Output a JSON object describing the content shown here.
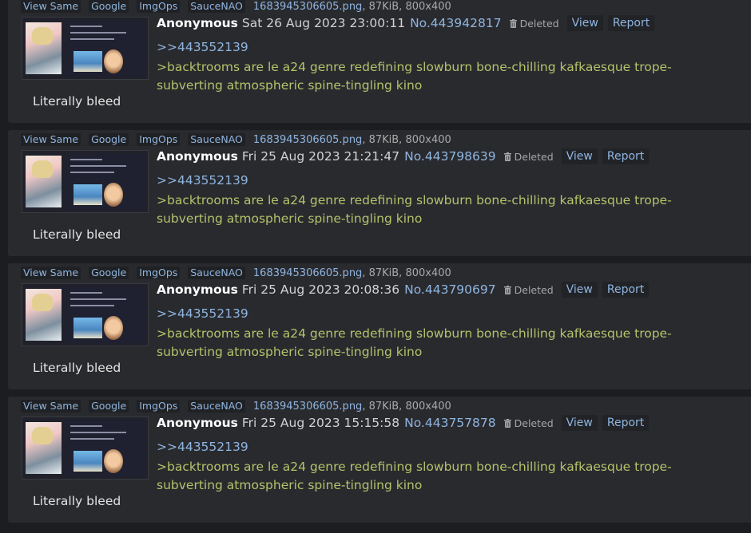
{
  "posts": [
    {
      "links": [
        "View Same",
        "Google",
        "ImgOps",
        "SauceNAO"
      ],
      "file_name": "1683945306605.png",
      "file_info": ", 87KiB, 800x400",
      "name": "Anonymous",
      "date": "Sat 26 Aug 2023 23:00:11",
      "post_no": "No.443942817",
      "deleted": "Deleted",
      "view": "View",
      "report": "Report",
      "quote": ">>443552139",
      "greentext": ">backtrooms are le a24 genre redefining slowburn bone-chilling kafkaesque trope-subverting atmospheric spine-tingling kino",
      "comment": "Literally bleed"
    },
    {
      "links": [
        "View Same",
        "Google",
        "ImgOps",
        "SauceNAO"
      ],
      "file_name": "1683945306605.png",
      "file_info": ", 87KiB, 800x400",
      "name": "Anonymous",
      "date": "Fri 25 Aug 2023 21:21:47",
      "post_no": "No.443798639",
      "deleted": "Deleted",
      "view": "View",
      "report": "Report",
      "quote": ">>443552139",
      "greentext": ">backtrooms are le a24 genre redefining slowburn bone-chilling kafkaesque trope-subverting atmospheric spine-tingling kino",
      "comment": "Literally bleed"
    },
    {
      "links": [
        "View Same",
        "Google",
        "ImgOps",
        "SauceNAO"
      ],
      "file_name": "1683945306605.png",
      "file_info": ", 87KiB, 800x400",
      "name": "Anonymous",
      "date": "Fri 25 Aug 2023 20:08:36",
      "post_no": "No.443790697",
      "deleted": "Deleted",
      "view": "View",
      "report": "Report",
      "quote": ">>443552139",
      "greentext": ">backtrooms are le a24 genre redefining slowburn bone-chilling kafkaesque trope-subverting atmospheric spine-tingling kino",
      "comment": "Literally bleed"
    },
    {
      "links": [
        "View Same",
        "Google",
        "ImgOps",
        "SauceNAO"
      ],
      "file_name": "1683945306605.png",
      "file_info": ", 87KiB, 800x400",
      "name": "Anonymous",
      "date": "Fri 25 Aug 2023 15:15:58",
      "post_no": "No.443757878",
      "deleted": "Deleted",
      "view": "View",
      "report": "Report",
      "quote": ">>443552139",
      "greentext": ">backtrooms are le a24 genre redefining slowburn bone-chilling kafkaesque trope-subverting atmospheric spine-tingling kino",
      "comment": "Literally bleed"
    }
  ]
}
